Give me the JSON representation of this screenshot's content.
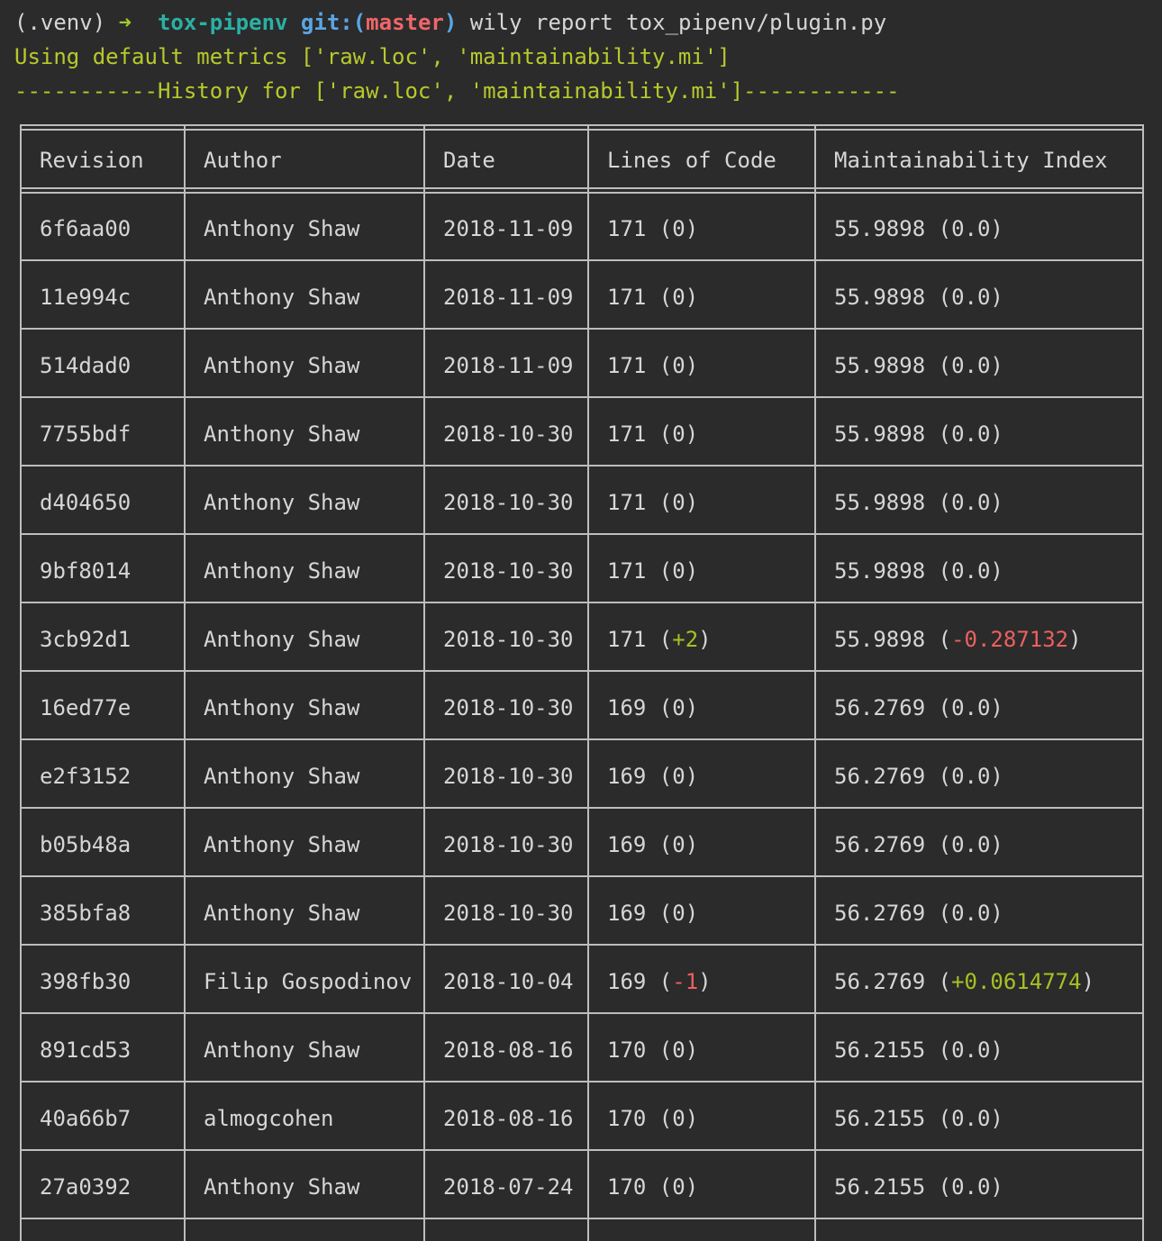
{
  "prompt": {
    "venv": "(.venv)",
    "arrow": "➜",
    "dir": "tox-pipenv",
    "git_label": "git:(",
    "branch": "master",
    "git_close": ")",
    "command": "wily report tox_pipenv/plugin.py"
  },
  "output": {
    "metrics_line": "Using default metrics ['raw.loc', 'maintainability.mi']",
    "history_line": "-----------History for ['raw.loc', 'maintainability.mi']------------"
  },
  "table": {
    "headers": [
      "Revision",
      "Author",
      "Date",
      "Lines of Code",
      "Maintainability Index"
    ],
    "rows": [
      {
        "revision": "6f6aa00",
        "author": "Anthony Shaw",
        "date": "2018-11-09",
        "loc": "171",
        "loc_delta": "0",
        "loc_delta_color": "default",
        "mi": "55.9898",
        "mi_delta": "0.0",
        "mi_delta_color": "default"
      },
      {
        "revision": "11e994c",
        "author": "Anthony Shaw",
        "date": "2018-11-09",
        "loc": "171",
        "loc_delta": "0",
        "loc_delta_color": "default",
        "mi": "55.9898",
        "mi_delta": "0.0",
        "mi_delta_color": "default"
      },
      {
        "revision": "514dad0",
        "author": "Anthony Shaw",
        "date": "2018-11-09",
        "loc": "171",
        "loc_delta": "0",
        "loc_delta_color": "default",
        "mi": "55.9898",
        "mi_delta": "0.0",
        "mi_delta_color": "default"
      },
      {
        "revision": "7755bdf",
        "author": "Anthony Shaw",
        "date": "2018-10-30",
        "loc": "171",
        "loc_delta": "0",
        "loc_delta_color": "default",
        "mi": "55.9898",
        "mi_delta": "0.0",
        "mi_delta_color": "default"
      },
      {
        "revision": "d404650",
        "author": "Anthony Shaw",
        "date": "2018-10-30",
        "loc": "171",
        "loc_delta": "0",
        "loc_delta_color": "default",
        "mi": "55.9898",
        "mi_delta": "0.0",
        "mi_delta_color": "default"
      },
      {
        "revision": "9bf8014",
        "author": "Anthony Shaw",
        "date": "2018-10-30",
        "loc": "171",
        "loc_delta": "0",
        "loc_delta_color": "default",
        "mi": "55.9898",
        "mi_delta": "0.0",
        "mi_delta_color": "default"
      },
      {
        "revision": "3cb92d1",
        "author": "Anthony Shaw",
        "date": "2018-10-30",
        "loc": "171",
        "loc_delta": "+2",
        "loc_delta_color": "green",
        "mi": "55.9898",
        "mi_delta": "-0.287132",
        "mi_delta_color": "red"
      },
      {
        "revision": "16ed77e",
        "author": "Anthony Shaw",
        "date": "2018-10-30",
        "loc": "169",
        "loc_delta": "0",
        "loc_delta_color": "default",
        "mi": "56.2769",
        "mi_delta": "0.0",
        "mi_delta_color": "default"
      },
      {
        "revision": "e2f3152",
        "author": "Anthony Shaw",
        "date": "2018-10-30",
        "loc": "169",
        "loc_delta": "0",
        "loc_delta_color": "default",
        "mi": "56.2769",
        "mi_delta": "0.0",
        "mi_delta_color": "default"
      },
      {
        "revision": "b05b48a",
        "author": "Anthony Shaw",
        "date": "2018-10-30",
        "loc": "169",
        "loc_delta": "0",
        "loc_delta_color": "default",
        "mi": "56.2769",
        "mi_delta": "0.0",
        "mi_delta_color": "default"
      },
      {
        "revision": "385bfa8",
        "author": "Anthony Shaw",
        "date": "2018-10-30",
        "loc": "169",
        "loc_delta": "0",
        "loc_delta_color": "default",
        "mi": "56.2769",
        "mi_delta": "0.0",
        "mi_delta_color": "default"
      },
      {
        "revision": "398fb30",
        "author": "Filip Gospodinov",
        "date": "2018-10-04",
        "loc": "169",
        "loc_delta": "-1",
        "loc_delta_color": "red",
        "mi": "56.2769",
        "mi_delta": "+0.0614774",
        "mi_delta_color": "green"
      },
      {
        "revision": "891cd53",
        "author": "Anthony Shaw",
        "date": "2018-08-16",
        "loc": "170",
        "loc_delta": "0",
        "loc_delta_color": "default",
        "mi": "56.2155",
        "mi_delta": "0.0",
        "mi_delta_color": "default"
      },
      {
        "revision": "40a66b7",
        "author": "almogcohen",
        "date": "2018-08-16",
        "loc": "170",
        "loc_delta": "0",
        "loc_delta_color": "default",
        "mi": "56.2155",
        "mi_delta": "0.0",
        "mi_delta_color": "default"
      },
      {
        "revision": "27a0392",
        "author": "Anthony Shaw",
        "date": "2018-07-24",
        "loc": "170",
        "loc_delta": "0",
        "loc_delta_color": "default",
        "mi": "56.2155",
        "mi_delta": "0.0",
        "mi_delta_color": "default"
      }
    ]
  },
  "colors": {
    "background": "#2b2b2b",
    "text": "#d6d6d6",
    "border": "#bdbdbd",
    "arrow": "#9ecb2d",
    "dir": "#2ab1a6",
    "git": "#5aa6e6",
    "branch": "#f0666a",
    "yellow_output": "#b8c92c",
    "delta_green": "#a8c023",
    "delta_red": "#ee5f5f"
  }
}
